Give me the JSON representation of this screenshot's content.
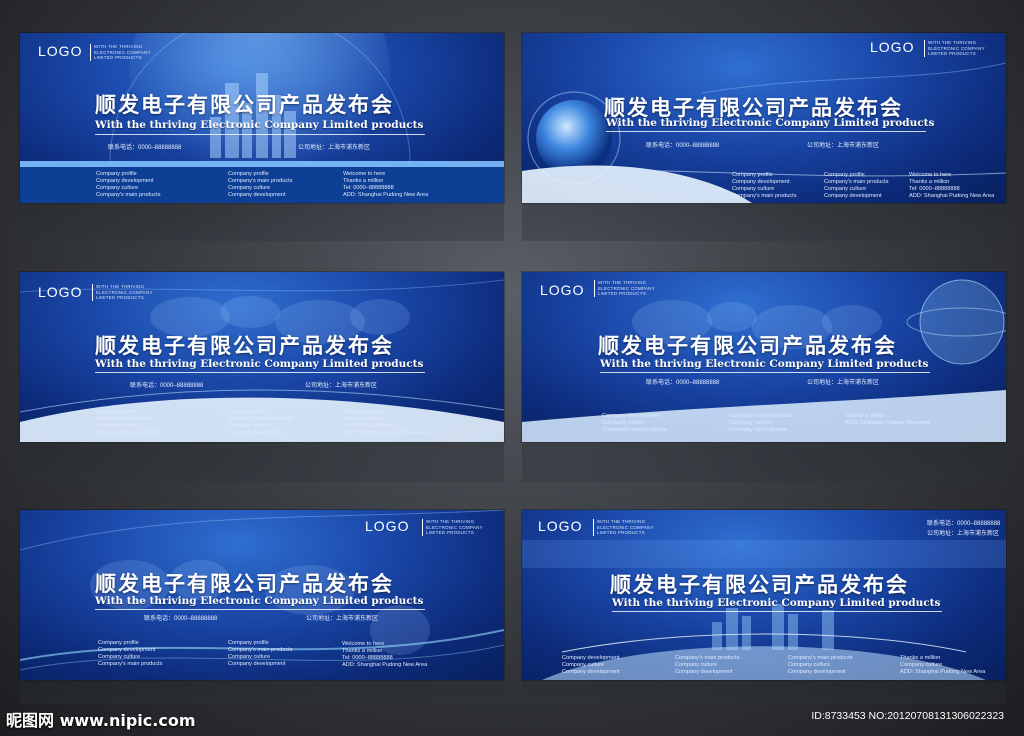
{
  "logo": "LOGO",
  "tagline": [
    "WITH THE THRIVING",
    "ELECTRONIC COMPANY",
    "LIMITED PRODUCTS"
  ],
  "title": "顺发电子有限公司产品发布会",
  "subtitle": "With the thriving Electronic Company Limited products",
  "phone": "联系电话：0000–88888888",
  "address": "公司地址：上海市浦东新区",
  "col1": [
    "Company profile",
    "Company development",
    "Company culture",
    "Company's main products"
  ],
  "col2": [
    "Company profile",
    "Company's main products",
    "Company culture",
    "Company development"
  ],
  "col3": [
    "Welcome to here",
    "Thanks a million",
    "Tel: 0000–88888888",
    "ADD: Shanghai Pudong New Area"
  ],
  "b4col1": [
    "Company development",
    "Company culture",
    "Company's main products"
  ],
  "b4col2": [
    "Company's main products",
    "Company culture",
    "Company development"
  ],
  "b4col3": [
    "Thanks a million",
    "ADD: Shanghai Pudong New Area"
  ],
  "b6col1": [
    "Company development",
    "Company culture",
    "Company development"
  ],
  "b6col2": [
    "Company's main products",
    "Company culture",
    "Company development"
  ],
  "b6col3": [
    "Company's main products",
    "Company culture",
    "Company development"
  ],
  "b6col4": [
    "Thanks a million",
    "Company culture",
    "ADD: Shanghai Pudong New Area"
  ],
  "b6phone": "联系电话：0000–88888888",
  "b6address": "公司地址：上海市浦东新区",
  "watermark": "昵图网 www.nipic.com",
  "image_id": "ID:8733453 NO:20120708131306022323",
  "colors": {
    "background": "#3a3d42",
    "banner_blue": "#1a47a8",
    "accent": "#4fb3ff"
  }
}
